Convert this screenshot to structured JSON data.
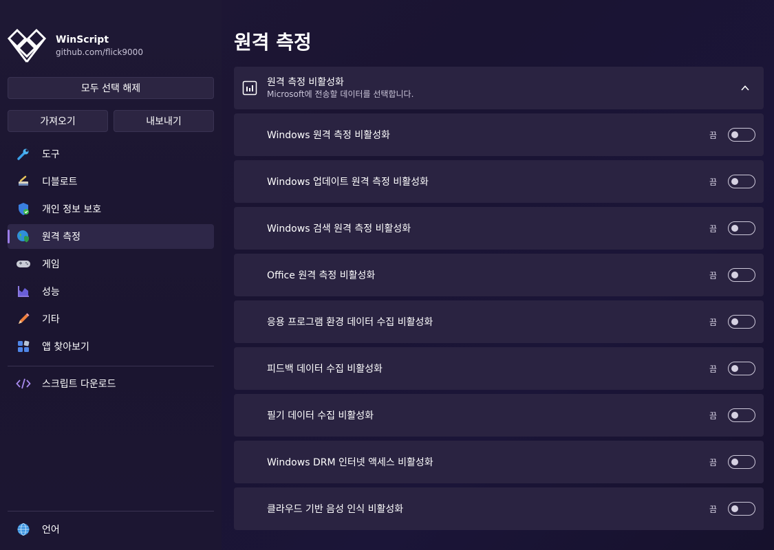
{
  "app": {
    "title": "WinScript",
    "subtitle": "github.com/flick9000"
  },
  "sidebar": {
    "deselect_all": "모두 선택 해제",
    "import": "가져오기",
    "export": "내보내기",
    "items": [
      {
        "label": "도구",
        "icon": "wrench-icon"
      },
      {
        "label": "디블로트",
        "icon": "broom-icon"
      },
      {
        "label": "개인 정보 보호",
        "icon": "shield-check-icon"
      },
      {
        "label": "원격 측정",
        "icon": "globe-shield-icon",
        "active": true
      },
      {
        "label": "게임",
        "icon": "gamepad-icon"
      },
      {
        "label": "성능",
        "icon": "performance-chart-icon"
      },
      {
        "label": "기타",
        "icon": "pencil-icon"
      },
      {
        "label": "앱 찾아보기",
        "icon": "apps-icon"
      }
    ],
    "download": "스크립트 다운로드",
    "language": "언어"
  },
  "main": {
    "title": "원격 측정",
    "group": {
      "title": "원격 측정 비활성화",
      "subtitle": "Microsoft에 전송할 데이터를 선택합니다."
    },
    "state_label": "끔",
    "options": [
      {
        "label": "Windows 원격 측정 비활성화",
        "on": false
      },
      {
        "label": "Windows 업데이트 원격 측정 비활성화",
        "on": false
      },
      {
        "label": "Windows 검색 원격 측정 비활성화",
        "on": false
      },
      {
        "label": "Office 원격 측정 비활성화",
        "on": false
      },
      {
        "label": "응용 프로그램 환경 데이터 수집 비활성화",
        "on": false
      },
      {
        "label": "피드백 데이터 수집 비활성화",
        "on": false
      },
      {
        "label": "필기 데이터 수집 비활성화",
        "on": false
      },
      {
        "label": "Windows DRM 인터넷 액세스 비활성화",
        "on": false
      },
      {
        "label": "클라우드 기반 음성 인식 비활성화",
        "on": false
      }
    ]
  },
  "colors": {
    "accent": "#9b7de8",
    "card": "#2a2341",
    "background": "#1b1530"
  }
}
